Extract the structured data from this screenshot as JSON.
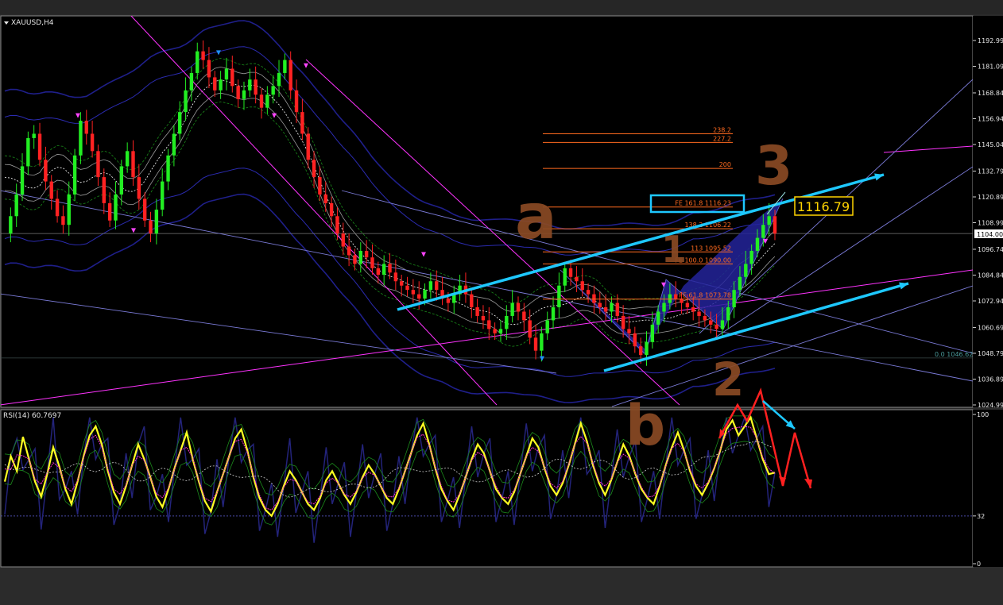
{
  "symbol_title": "XAUUSD,H4",
  "rsi_title": "RSI(14) 60.7697",
  "chart_data": [
    {
      "type": "line",
      "title": "XAUUSD,H4",
      "ylim": [
        1019.0,
        1199.0
      ],
      "y_ticks": [
        "1192.99",
        "1181.09",
        "1168.84",
        "1156.94",
        "1145.04",
        "1132.79",
        "1120.89",
        "1108.99",
        "1096.74",
        "1084.84",
        "1072.94",
        "1060.69",
        "1048.79",
        "1036.89",
        "1024.99"
      ],
      "y_tick_values": [
        1192.99,
        1181.09,
        1168.84,
        1156.94,
        1145.04,
        1132.79,
        1120.89,
        1108.99,
        1096.74,
        1084.84,
        1072.94,
        1060.69,
        1048.79,
        1036.89,
        1024.99
      ],
      "current_price_label": "1104.00",
      "current_price": 1104.0,
      "price_series": [
        1104,
        1112,
        1122,
        1135,
        1148,
        1150,
        1138,
        1128,
        1120,
        1112,
        1108,
        1122,
        1140,
        1156,
        1150,
        1142,
        1130,
        1118,
        1110,
        1122,
        1135,
        1142,
        1130,
        1120,
        1110,
        1104,
        1115,
        1128,
        1140,
        1150,
        1160,
        1170,
        1178,
        1188,
        1184,
        1176,
        1170,
        1175,
        1180,
        1172,
        1166,
        1170,
        1175,
        1168,
        1162,
        1168,
        1172,
        1178,
        1184,
        1170,
        1160,
        1150,
        1138,
        1130,
        1122,
        1118,
        1112,
        1104,
        1098,
        1094,
        1090,
        1096,
        1093,
        1088,
        1085,
        1090,
        1086,
        1082,
        1080,
        1078,
        1076,
        1074,
        1078,
        1082,
        1078,
        1074,
        1072,
        1076,
        1080,
        1076,
        1070,
        1066,
        1064,
        1060,
        1058,
        1060,
        1066,
        1072,
        1068,
        1064,
        1056,
        1050,
        1058,
        1064,
        1070,
        1080,
        1088,
        1084,
        1082,
        1078,
        1076,
        1072,
        1070,
        1068,
        1072,
        1066,
        1060,
        1058,
        1052,
        1048,
        1054,
        1062,
        1068,
        1072,
        1076,
        1074,
        1072,
        1070,
        1068,
        1066,
        1064,
        1062,
        1060,
        1064,
        1070,
        1078,
        1084,
        1090,
        1096,
        1102,
        1108,
        1112,
        1104
      ],
      "fibonacci_levels": [
        {
          "label": "238.2",
          "value": 1150.0
        },
        {
          "label": "227.2",
          "value": 1146.0
        },
        {
          "label": "200",
          "value": 1134.0
        },
        {
          "label": "FE 161.8 1116.23",
          "value": 1116.23
        },
        {
          "label": "138.2 1106.22",
          "value": 1106.22
        },
        {
          "label": "113 1095.52",
          "value": 1095.52
        },
        {
          "label": "FE 100.0 1090.00",
          "value": 1090.0
        },
        {
          "label": "FE 61.8 1073.78",
          "value": 1073.78
        },
        {
          "label": "0.0 1046.62",
          "value": 1046.62
        }
      ],
      "target_box_label": "1116.79",
      "annotations": [
        "a",
        "1",
        "3",
        "2",
        "b"
      ],
      "colors": {
        "background": "#000000",
        "bull_candle": "#22ee22",
        "bear_candle": "#ff2222",
        "fib": "#ff6a1f",
        "channel": "#ff33ff",
        "trendline": "#1ec8ff",
        "harmonic_fill": "#23239a",
        "handwriting": "#8a4a24",
        "bands": "#2a2a9a"
      }
    },
    {
      "type": "line",
      "title": "RSI(14) 60.7697",
      "ylim": [
        0,
        100
      ],
      "y_ticks": [
        "100",
        "32",
        "0"
      ],
      "y_tick_values": [
        100,
        32,
        0
      ],
      "last_value": 60.7697,
      "rsi_series": [
        55,
        72,
        62,
        85,
        70,
        55,
        45,
        60,
        78,
        65,
        50,
        40,
        55,
        72,
        86,
        92,
        80,
        62,
        48,
        40,
        52,
        66,
        80,
        70,
        58,
        45,
        38,
        50,
        64,
        76,
        88,
        70,
        55,
        42,
        35,
        48,
        60,
        72,
        84,
        90,
        76,
        58,
        44,
        36,
        32,
        40,
        52,
        62,
        56,
        48,
        40,
        36,
        44,
        56,
        62,
        54,
        46,
        40,
        48,
        58,
        66,
        60,
        52,
        44,
        40,
        50,
        62,
        74,
        86,
        94,
        80,
        64,
        50,
        42,
        36,
        46,
        58,
        70,
        80,
        74,
        62,
        50,
        44,
        40,
        48,
        60,
        72,
        84,
        78,
        64,
        52,
        46,
        54,
        66,
        80,
        94,
        82,
        66,
        54,
        46,
        56,
        68,
        80,
        72,
        60,
        50,
        44,
        40,
        52,
        66,
        78,
        88,
        76,
        62,
        52,
        46,
        54,
        64,
        76,
        90,
        96,
        86,
        92,
        98,
        84,
        70,
        60,
        61
      ]
    }
  ]
}
